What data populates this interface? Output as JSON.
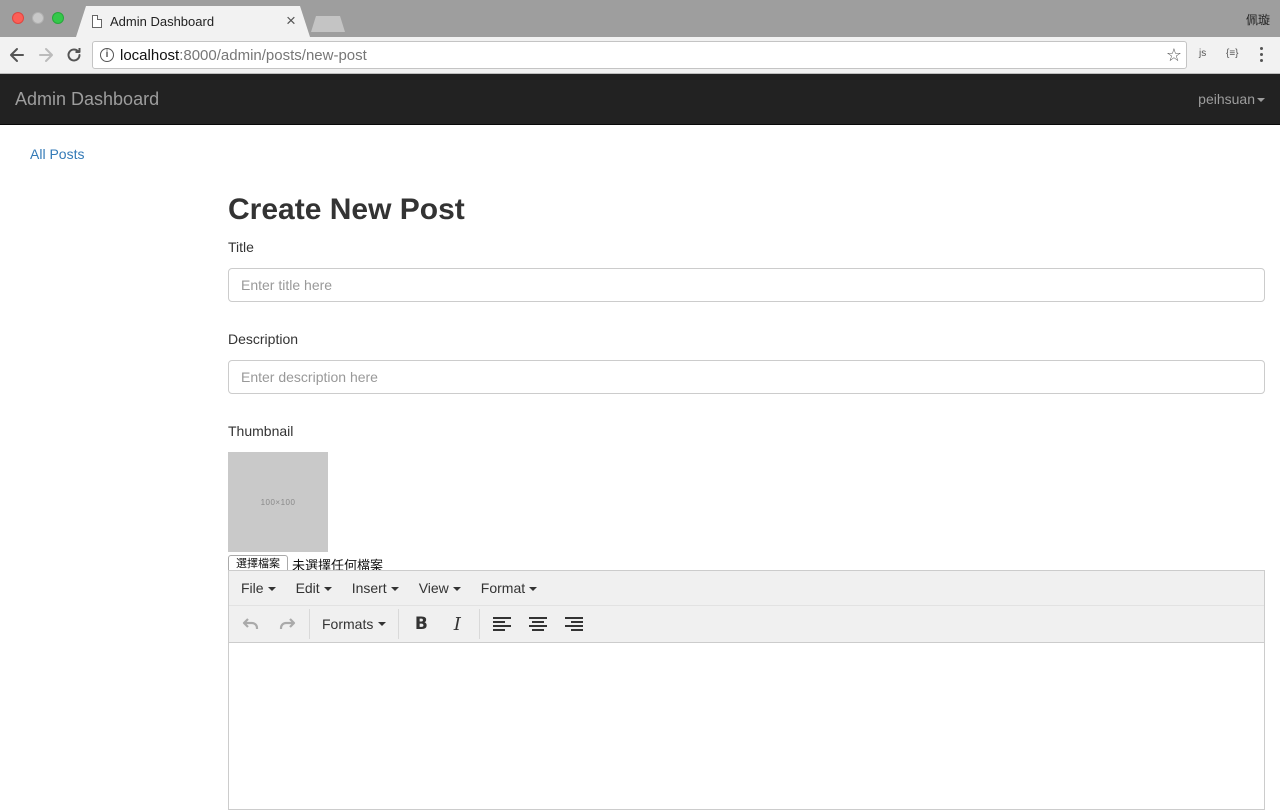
{
  "browser": {
    "tab_title": "Admin Dashboard",
    "tab_close": "×",
    "profile_name": "佩璇",
    "url_host": "localhost",
    "url_path": ":8000/admin/posts/new-post",
    "info_glyph": "i",
    "star_glyph": "☆",
    "ext_js": "js",
    "ext_json": "{≡}"
  },
  "navbar": {
    "brand": "Admin Dashboard",
    "user": "peihsuan"
  },
  "sidebar": {
    "all_posts": "All Posts"
  },
  "form": {
    "heading": "Create New Post",
    "title_label": "Title",
    "title_placeholder": "Enter title here",
    "description_label": "Description",
    "description_placeholder": "Enter description here",
    "thumbnail_label": "Thumbnail",
    "thumbnail_placeholder_text": "100×100",
    "file_button": "選擇檔案",
    "file_status": "未選擇任何檔案"
  },
  "editor": {
    "menus": [
      "File",
      "Edit",
      "Insert",
      "View",
      "Format"
    ],
    "formats_label": "Formats",
    "undo_glyph": "↶",
    "redo_glyph": "↷",
    "bold_glyph": "B",
    "italic_glyph": "I"
  },
  "colors": {
    "navbar_bg": "#222222",
    "navbar_text": "#9d9d9d",
    "link": "#337ab7",
    "editor_toolbar_bg": "#f0f0f0"
  }
}
